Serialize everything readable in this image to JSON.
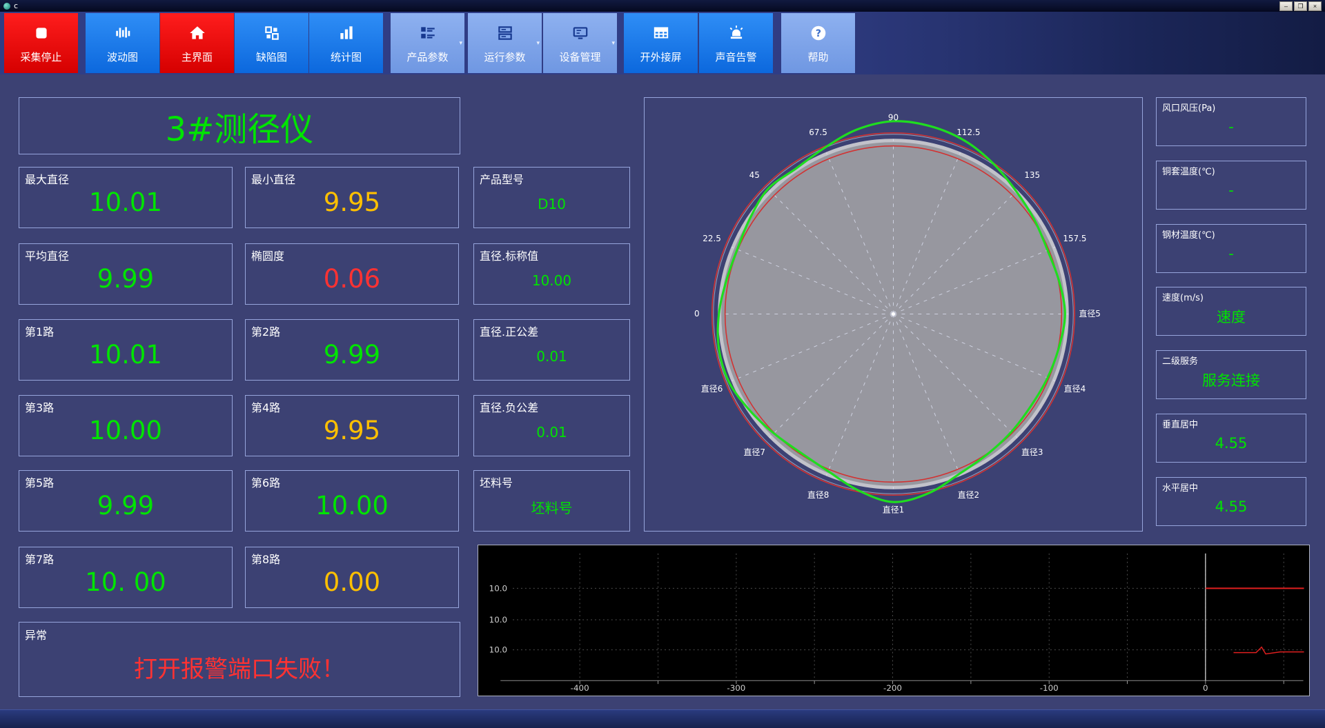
{
  "window": {
    "title": "c",
    "minimize": "–",
    "maximize": "❐",
    "close": "×"
  },
  "toolbar": {
    "items": [
      {
        "label": "采集停止"
      },
      {
        "label": "波动图"
      },
      {
        "label": "主界面"
      },
      {
        "label": "缺陷图"
      },
      {
        "label": "统计图"
      },
      {
        "label": "产品参数"
      },
      {
        "label": "运行参数"
      },
      {
        "label": "设备管理"
      },
      {
        "label": "开外接屏"
      },
      {
        "label": "声音告警"
      },
      {
        "label": "帮助"
      }
    ]
  },
  "main_title": "3#测径仪",
  "metrics": {
    "col1": [
      {
        "label": "最大直径",
        "value": "10.01",
        "color": "green"
      },
      {
        "label": "平均直径",
        "value": "9.99",
        "color": "green"
      },
      {
        "label": "第1路",
        "value": "10.01",
        "color": "green"
      },
      {
        "label": "第3路",
        "value": "10.00",
        "color": "green"
      },
      {
        "label": "第5路",
        "value": "9.99",
        "color": "green"
      },
      {
        "label": "第7路",
        "value": "10. 00",
        "color": "green"
      }
    ],
    "col2": [
      {
        "label": "最小直径",
        "value": "9.95",
        "color": "yellow"
      },
      {
        "label": "椭圆度",
        "value": "0.06",
        "color": "red"
      },
      {
        "label": "第2路",
        "value": "9.99",
        "color": "green"
      },
      {
        "label": "第4路",
        "value": "9.95",
        "color": "yellow"
      },
      {
        "label": "第6路",
        "value": "10.00",
        "color": "green"
      },
      {
        "label": "第8路",
        "value": "0.00",
        "color": "yellow"
      }
    ],
    "col3": [
      {
        "label": "产品型号",
        "value": "D10",
        "color": "green"
      },
      {
        "label": "直径.标称值",
        "value": "10.00",
        "color": "green"
      },
      {
        "label": "直径.正公差",
        "value": "0.01",
        "color": "green"
      },
      {
        "label": "直径.负公差",
        "value": "0.01",
        "color": "green"
      },
      {
        "label": "坯料号",
        "value": "坯料号",
        "color": "green"
      }
    ]
  },
  "alarm": {
    "label": "异常",
    "message": "打开报警端口失败！",
    "color": "red"
  },
  "status_panel": [
    {
      "label": "风口风压(Pa)",
      "value": "-",
      "color": "green"
    },
    {
      "label": "铜套温度(℃)",
      "value": "-",
      "color": "green"
    },
    {
      "label": "钢材温度(℃)",
      "value": "-",
      "color": "green"
    },
    {
      "label": "速度(m/s)",
      "value": "速度",
      "color": "green"
    },
    {
      "label": "二级服务",
      "value": "服务连接",
      "color": "green"
    },
    {
      "label": "垂直居中",
      "value": "4.55",
      "color": "green"
    },
    {
      "label": "水平居中",
      "value": "4.55",
      "color": "green"
    }
  ],
  "polar": {
    "axis_labels": [
      {
        "text": "0",
        "angle": 180
      },
      {
        "text": "22.5",
        "angle": 157.5
      },
      {
        "text": "45",
        "angle": 135
      },
      {
        "text": "67.5",
        "angle": 112.5
      },
      {
        "text": "90",
        "angle": 90
      },
      {
        "text": "112.5",
        "angle": 67.5
      },
      {
        "text": "135",
        "angle": 45
      },
      {
        "text": "157.5",
        "angle": 22.5
      },
      {
        "text": "直径5",
        "angle": 0
      },
      {
        "text": "直径4",
        "angle": -22.5
      },
      {
        "text": "直径3",
        "angle": -45
      },
      {
        "text": "直径2",
        "angle": -67.5
      },
      {
        "text": "直径1",
        "angle": -90
      },
      {
        "text": "直径8",
        "angle": -112.5
      },
      {
        "text": "直径7",
        "angle": -135
      },
      {
        "text": "直径6",
        "angle": -157.5
      }
    ],
    "profile_radii": [
      250,
      246,
      243,
      247,
      253,
      263,
      273,
      279,
      281,
      274,
      262,
      255,
      258,
      251,
      246,
      248,
      254,
      259,
      259,
      252,
      246,
      243,
      248,
      262,
      274,
      266,
      252,
      246,
      243,
      241,
      243,
      246
    ]
  },
  "trend": {
    "y_labels": [
      "10.0",
      "10.0",
      "10.0"
    ],
    "x_labels": [
      "-400",
      "-300",
      "-200",
      "-100",
      "0"
    ]
  },
  "colors": {
    "green": "#00e400",
    "yellow": "#ffc000",
    "red": "#ff3232"
  }
}
